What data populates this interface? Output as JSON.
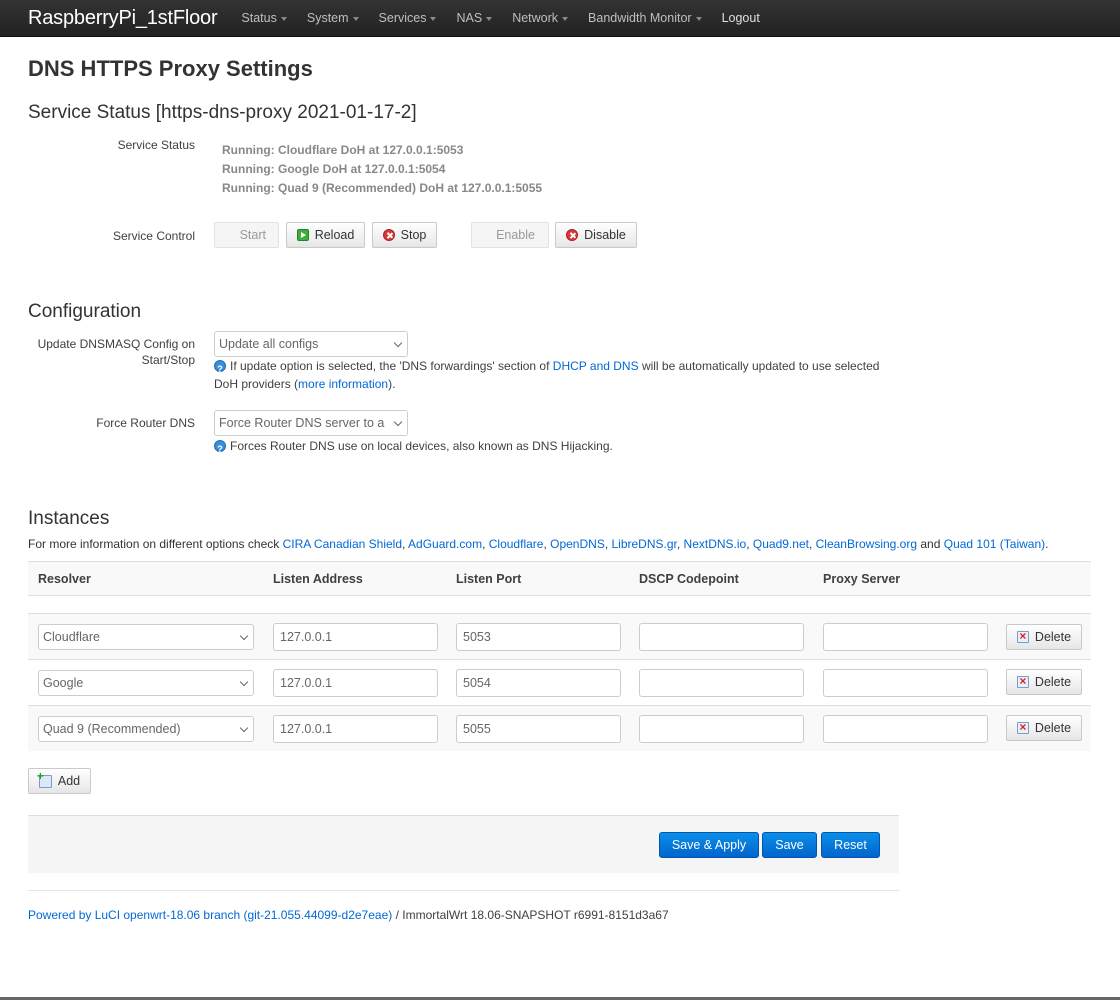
{
  "header": {
    "brand": "RaspberryPi_1stFloor",
    "menu": [
      {
        "label": "Status",
        "dropdown": true
      },
      {
        "label": "System",
        "dropdown": true
      },
      {
        "label": "Services",
        "dropdown": true
      },
      {
        "label": "NAS",
        "dropdown": true
      },
      {
        "label": "Network",
        "dropdown": true
      },
      {
        "label": "Bandwidth Monitor",
        "dropdown": true
      },
      {
        "label": "Logout",
        "dropdown": false
      }
    ]
  },
  "page": {
    "title": "DNS HTTPS Proxy Settings"
  },
  "service_status": {
    "section_title": "Service Status [https-dns-proxy 2021-01-17-2]",
    "status_label": "Service Status",
    "status_lines": [
      "Running: Cloudflare DoH at 127.0.0.1:5053",
      "Running: Google DoH at 127.0.0.1:5054",
      "Running: Quad 9 (Recommended) DoH at 127.0.0.1:5055"
    ],
    "control_label": "Service Control",
    "buttons": {
      "start": "Start",
      "reload": "Reload",
      "stop": "Stop",
      "enable": "Enable",
      "disable": "Disable"
    }
  },
  "configuration": {
    "section_title": "Configuration",
    "update_dnsmasq": {
      "label_line1": "Update DNSMASQ Config on",
      "label_line2": "Start/Stop",
      "value": "Update all configs",
      "help_pre": "If update option is selected, the 'DNS forwardings' section of",
      "help_link": "DHCP and DNS",
      "help_mid": "will be automatically updated to use selected",
      "help_line2_pre": "DoH providers (",
      "help_line2_link": "more information",
      "help_line2_post": ")."
    },
    "force_router_dns": {
      "label": "Force Router DNS",
      "value": "Force Router DNS server to all local devices",
      "help": "Forces Router DNS use on local devices, also known as DNS Hijacking."
    }
  },
  "instances": {
    "section_title": "Instances",
    "desc_pre": "For more information on different options check",
    "links": [
      "CIRA Canadian Shield",
      "AdGuard.com",
      "Cloudflare",
      "OpenDNS",
      "LibreDNS.gr",
      "NextDNS.io",
      "Quad9.net",
      "CleanBrowsing.org"
    ],
    "desc_and": "and",
    "last_link": "Quad 101 (Taiwan)",
    "desc_end": ".",
    "columns": [
      "Resolver",
      "Listen Address",
      "Listen Port",
      "DSCP Codepoint",
      "Proxy Server"
    ],
    "rows": [
      {
        "resolver": "Cloudflare",
        "listen_address": "127.0.0.1",
        "listen_port": "5053",
        "dscp": "",
        "proxy": "",
        "delete_label": "Delete"
      },
      {
        "resolver": "Google",
        "listen_address": "127.0.0.1",
        "listen_port": "5054",
        "dscp": "",
        "proxy": "",
        "delete_label": "Delete"
      },
      {
        "resolver": "Quad 9 (Recommended)",
        "listen_address": "127.0.0.1",
        "listen_port": "5055",
        "dscp": "",
        "proxy": "",
        "delete_label": "Delete"
      }
    ],
    "add_label": "Add"
  },
  "actions": {
    "save_apply": "Save & Apply",
    "save": "Save",
    "reset": "Reset"
  },
  "footer": {
    "link_text": "Powered by LuCI openwrt-18.06 branch (git-21.055.44099-d2e7eae)",
    "separator": " / ",
    "version_text": "ImmortalWrt 18.06-SNAPSHOT r6991-8151d3a67"
  }
}
